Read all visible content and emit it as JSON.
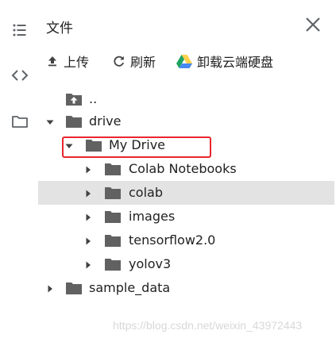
{
  "panel": {
    "title": "文件"
  },
  "toolbar": {
    "upload_label": "上传",
    "refresh_label": "刷新",
    "mount_drive_label": "卸载云端硬盘"
  },
  "rail": {
    "icons": [
      "list-icon",
      "code-icon",
      "folder-icon"
    ]
  },
  "tree": {
    "parent_label": "..",
    "drive_label": "drive",
    "my_drive_label": "My Drive",
    "colab_notebooks_label": "Colab Notebooks",
    "colab_label": "colab",
    "images_label": "images",
    "tensorflow_label": "tensorflow2.0",
    "yolov3_label": "yolov3",
    "sample_data_label": "sample_data",
    "selected_item": "colab"
  },
  "colors": {
    "folder": "#616161",
    "selected_row": "#e3e3e3",
    "highlight_box": "#e8262d",
    "drive_green": "#1fa463",
    "drive_yellow": "#ffd04b",
    "drive_blue": "#4688f4"
  },
  "watermark": {
    "text": "https://blog.csdn.net/weixin_43972443"
  }
}
